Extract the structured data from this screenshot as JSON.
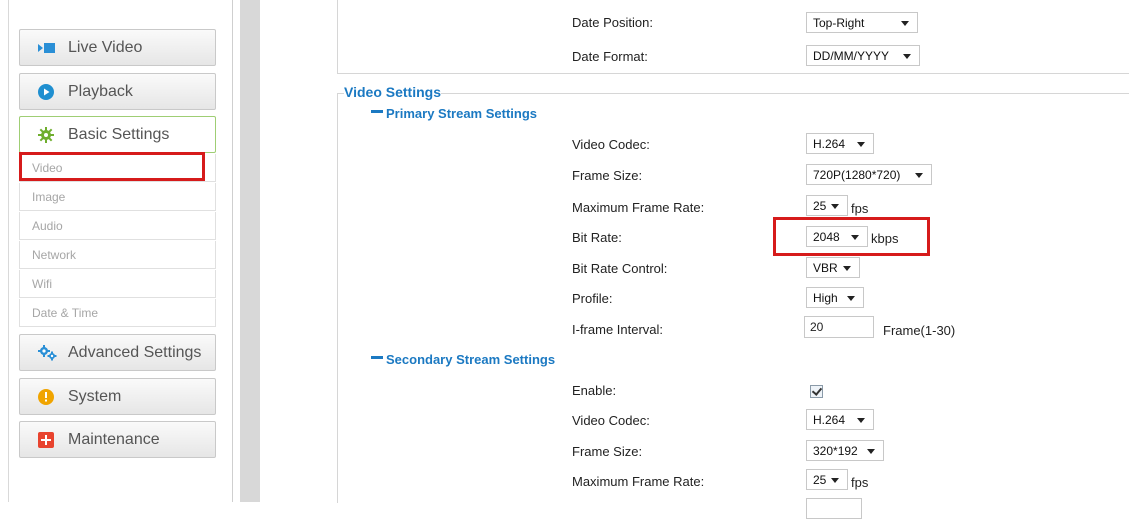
{
  "sidebar": {
    "buttons": [
      {
        "label": "Live Video",
        "icon": "live-video-icon"
      },
      {
        "label": "Playback",
        "icon": "playback-icon"
      },
      {
        "label": "Basic Settings",
        "icon": "gear-icon"
      },
      {
        "label": "Advanced Settings",
        "icon": "gears-icon"
      },
      {
        "label": "System",
        "icon": "info-icon"
      },
      {
        "label": "Maintenance",
        "icon": "plus-icon"
      }
    ],
    "sub_items": [
      "Video",
      "Image",
      "Audio",
      "Network",
      "Wifi",
      "Date & Time"
    ]
  },
  "osd": {
    "date_position_label": "Date Position:",
    "date_position_value": "Top-Right",
    "date_format_label": "Date Format:",
    "date_format_value": "DD/MM/YYYY"
  },
  "video_settings": {
    "title": "Video Settings",
    "primary": {
      "title": "Primary Stream Settings",
      "video_codec_label": "Video Codec:",
      "video_codec_value": "H.264",
      "frame_size_label": "Frame Size:",
      "frame_size_value": "720P(1280*720)",
      "max_frame_rate_label": "Maximum Frame Rate:",
      "max_frame_rate_value": "25",
      "fps_unit": "fps",
      "bit_rate_label": "Bit Rate:",
      "bit_rate_value": "2048",
      "kbps_unit": "kbps",
      "bit_rate_control_label": "Bit Rate Control:",
      "bit_rate_control_value": "VBR",
      "profile_label": "Profile:",
      "profile_value": "High",
      "iframe_label": "I-frame Interval:",
      "iframe_value": "20",
      "iframe_unit": "Frame(1-30)"
    },
    "secondary": {
      "title": "Secondary Stream Settings",
      "enable_label": "Enable:",
      "enable_checked": true,
      "video_codec_label": "Video Codec:",
      "video_codec_value": "H.264",
      "frame_size_label": "Frame Size:",
      "frame_size_value": "320*192",
      "max_frame_rate_label": "Maximum Frame Rate:",
      "max_frame_rate_value": "25",
      "fps_unit": "fps"
    }
  },
  "colors": {
    "accent": "#1b79c2",
    "highlight": "#d61b1b",
    "active_border": "#9fce74"
  }
}
